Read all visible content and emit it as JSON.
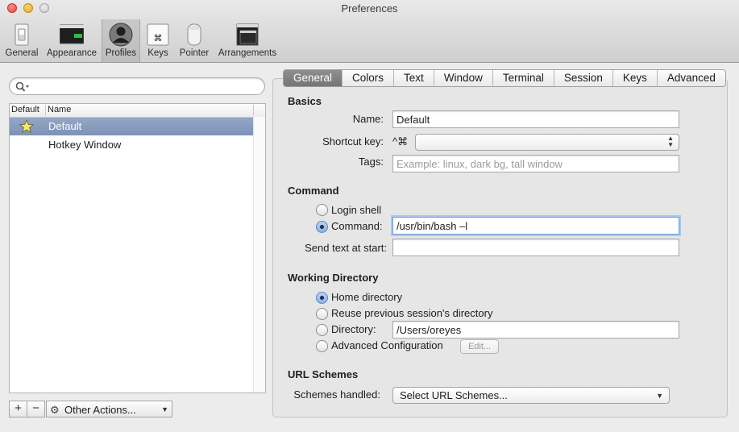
{
  "window": {
    "title": "Preferences"
  },
  "toolbar": {
    "items": [
      {
        "label": "General",
        "icon": "switch-icon"
      },
      {
        "label": "Appearance",
        "icon": "monitor-icon"
      },
      {
        "label": "Profiles",
        "icon": "person-icon",
        "selected": true
      },
      {
        "label": "Keys",
        "icon": "command-key-icon"
      },
      {
        "label": "Pointer",
        "icon": "mouse-icon"
      },
      {
        "label": "Arrangements",
        "icon": "windows-icon"
      }
    ]
  },
  "profiles": {
    "search_value": "",
    "columns": {
      "default": "Default",
      "name": "Name"
    },
    "rows": [
      {
        "name": "Default",
        "is_default": true,
        "selected": true
      },
      {
        "name": "Hotkey Window",
        "is_default": false,
        "selected": false
      }
    ],
    "add_label": "+",
    "remove_label": "−",
    "actions_label": "Other Actions...",
    "gear_glyph": "⚙",
    "dropdown_glyph": "▼"
  },
  "tabs": [
    "General",
    "Colors",
    "Text",
    "Window",
    "Terminal",
    "Session",
    "Keys",
    "Advanced"
  ],
  "active_tab": "General",
  "basics": {
    "title": "Basics",
    "name_label": "Name:",
    "name_value": "Default",
    "shortcut_label": "Shortcut key:",
    "shortcut_modifiers": "^⌘",
    "shortcut_value": "",
    "tags_label": "Tags:",
    "tags_placeholder": "Example: linux, dark bg, tall window"
  },
  "command": {
    "title": "Command",
    "login_shell_label": "Login shell",
    "command_label": "Command:",
    "command_value": "/usr/bin/bash –l",
    "selected": "command",
    "send_text_label": "Send text at start:",
    "send_text_value": ""
  },
  "working_directory": {
    "title": "Working Directory",
    "home_label": "Home directory",
    "reuse_label": "Reuse previous session's directory",
    "directory_label": "Directory:",
    "directory_value": "/Users/oreyes",
    "advanced_label": "Advanced Configuration",
    "edit_label": "Edit...",
    "selected": "home"
  },
  "url_schemes": {
    "title": "URL Schemes",
    "schemes_label": "Schemes handled:",
    "schemes_value": "Select URL Schemes..."
  },
  "colors": {
    "selection": "#7d92b6",
    "focus_ring": "#6d9bd8",
    "active_tab": "#7f7f7f"
  }
}
